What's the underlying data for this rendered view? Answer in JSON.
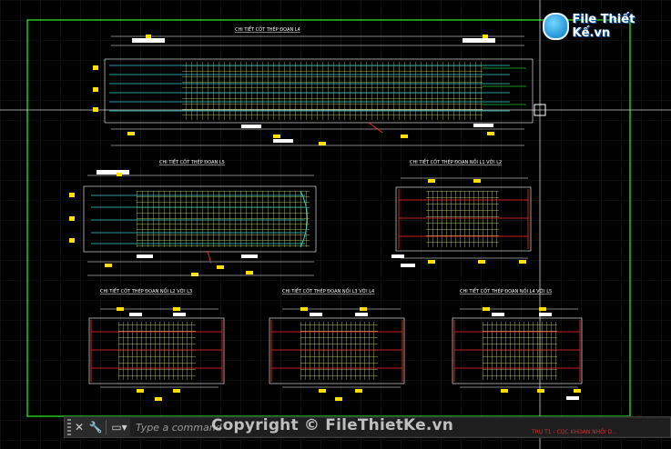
{
  "logo": {
    "text": "File Thiết Kế.vn"
  },
  "drawings": [
    {
      "title": "CHI TIẾT CỐT THÉP ĐOẠN L4"
    },
    {
      "title": "CHI TIẾT CỐT THÉP ĐOẠN L5"
    },
    {
      "title": "CHI TIẾT CỐT THÉP ĐOẠN NỐI L1 VỚI L2"
    },
    {
      "title": "CHI TIẾT CỐT THÉP ĐOẠN NỐI L2 VỚI L3"
    },
    {
      "title": "CHI TIẾT CỐT THÉP ĐOẠN NỐI L3 VỚI L4"
    },
    {
      "title": "CHI TIẾT CỐT THÉP ĐOẠN NỐI L4 VỚI L5"
    }
  ],
  "command_line": {
    "placeholder": "Type a command",
    "close_icon": "close-icon",
    "settings_icon": "wrench-icon"
  },
  "watermark": "Copyright © FileThietKe.vn",
  "status_text": "TRỤ T1 - CỌC KHOAN NHỒI D...",
  "colors": {
    "frame": "#1fc81f",
    "rebar_main": "#d7f07a",
    "rebar_cyan": "#39d1d1",
    "dimension": "#ffffff",
    "label_yellow": "#ffe000",
    "red": "#ff2a2a"
  }
}
